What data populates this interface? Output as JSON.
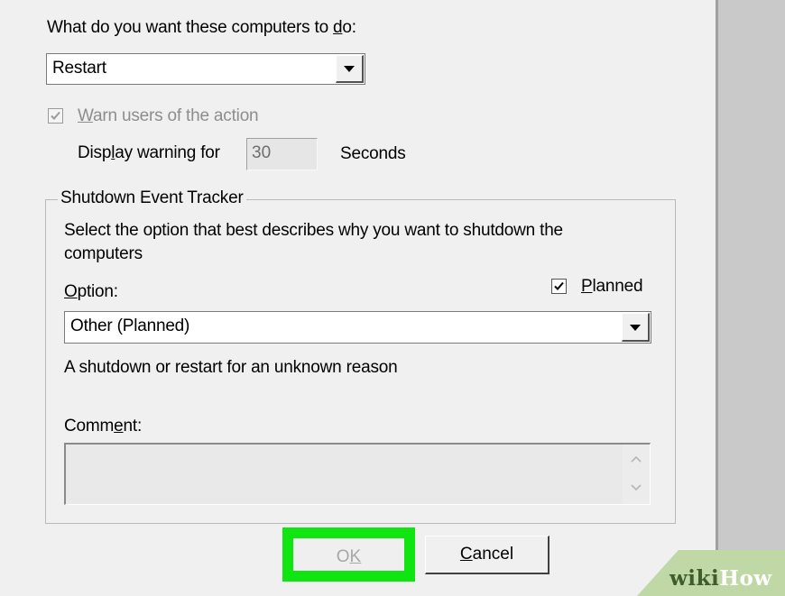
{
  "action": {
    "prompt_pre": "What do you want these computers to ",
    "prompt_key": "d",
    "prompt_post": "o:",
    "selected": "Restart"
  },
  "warn": {
    "checkbox_checked": true,
    "label_key": "W",
    "label_rest": "arn users of the action",
    "display_pre": "Disp",
    "display_key": "l",
    "display_post": "ay warning for",
    "seconds_value": "30",
    "seconds_label": "Seconds"
  },
  "tracker": {
    "group_title": "Shutdown Event Tracker",
    "description_line1": "Select the option that best describes why you want to shutdown the",
    "description_line2": "computers",
    "option_key": "O",
    "option_rest": "ption:",
    "planned_checked": true,
    "planned_key": "P",
    "planned_rest": "lanned",
    "option_selected": "Other (Planned)",
    "option_description": "A shutdown or restart for an unknown reason",
    "comment_pre": "Comm",
    "comment_key": "e",
    "comment_post": "nt:",
    "comment_value": ""
  },
  "buttons": {
    "ok_pre": "O",
    "ok_key": "K",
    "cancel_key": "C",
    "cancel_rest": "ancel"
  },
  "watermark": {
    "part1": "wiki",
    "part2": "How"
  },
  "colors": {
    "highlight": "#11e511",
    "dialog_bg": "#f0f0f0"
  }
}
